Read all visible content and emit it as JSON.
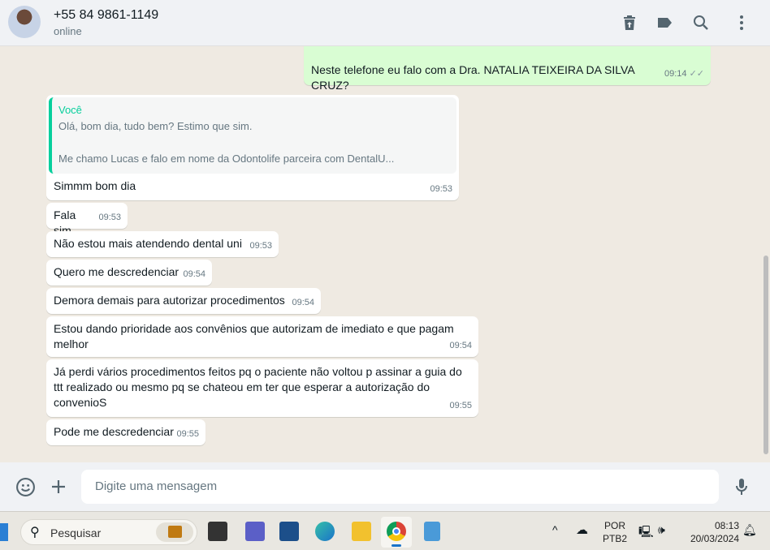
{
  "header": {
    "contact": "+55 84 9861-1149",
    "status": "online"
  },
  "messages": [
    {
      "dir": "out",
      "text": "Neste telefone eu falo com a Dra. NATALIA TEIXEIRA DA SILVA CRUZ?",
      "time": "09:14"
    },
    {
      "dir": "in",
      "quote_author": "Você",
      "quote_line1": "Olá, bom dia, tudo bem? Estimo que sim.",
      "quote_line2": "Me chamo Lucas e falo em nome da Odontolife parceira com DentalU...",
      "text": "Simmm bom dia",
      "time": "09:53"
    },
    {
      "dir": "in",
      "text": "Fala sim",
      "time": "09:53"
    },
    {
      "dir": "in",
      "text": "Não estou mais atendendo dental uni",
      "time": "09:53"
    },
    {
      "dir": "in",
      "text": "Quero me descredenciar",
      "time": "09:54"
    },
    {
      "dir": "in",
      "text": "Demora demais para autorizar procedimentos",
      "time": "09:54"
    },
    {
      "dir": "in",
      "text": "Estou dando prioridade aos convênios que autorizam de imediato e que pagam melhor",
      "time": "09:54"
    },
    {
      "dir": "in",
      "text": "Já perdi vários procedimentos feitos pq o paciente não voltou p assinar a guia do ttt realizado ou mesmo pq se chateou em ter que esperar a autorização do convenioS",
      "time": "09:55"
    },
    {
      "dir": "in",
      "text": "Pode me descredenciar",
      "time": "09:55"
    }
  ],
  "composer": {
    "placeholder": "Digite uma mensagem"
  },
  "taskbar": {
    "search": "Pesquisar",
    "lang1": "POR",
    "lang2": "PTB2",
    "time": "08:13",
    "date": "20/03/2024"
  }
}
